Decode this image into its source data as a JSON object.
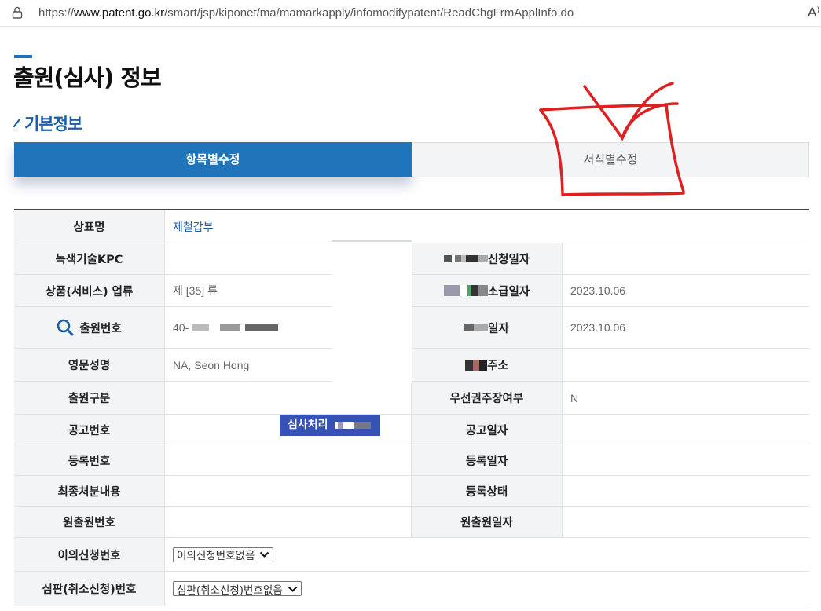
{
  "browser": {
    "url_prefix": "https://",
    "url_host": "www.patent.go.kr",
    "url_path": "/smart/jsp/kiponet/ma/mamarkapply/infomodifypatent/ReadChgFrmApplInfo.do",
    "reader_glyph": "A⁾"
  },
  "page": {
    "title": "출원(심사) 정보",
    "section_title": "기본정보"
  },
  "tabs": [
    {
      "label": "항목별수정",
      "active": true
    },
    {
      "label": "서식별수정",
      "active": false
    }
  ],
  "info": {
    "trademark_name_label": "상표명",
    "trademark_name_value": "제철갑부",
    "green_kpc_label": "녹색기술KPC",
    "request_date_label": "신청일자",
    "goods_class_label": "상품(서비스) 업류",
    "goods_class_value": "제 [35] 류",
    "retro_date_label": "소급일자",
    "retro_date_value": "2023.10.06",
    "app_number_label": "출원번호",
    "app_number_value": "40-",
    "exam_badge": "심사처리",
    "date_label": "일자",
    "date_value": "2023.10.06",
    "english_name_label": "영문성명",
    "english_name_value": "NA, Seon Hong",
    "address_label": "주소",
    "app_type_label": "출원구분",
    "priority_label": "우선권주장여부",
    "priority_value": "N",
    "pub_number_label": "공고번호",
    "pub_date_label": "공고일자",
    "reg_number_label": "등록번호",
    "reg_date_label": "등록일자",
    "final_disposition_label": "최종처분내용",
    "reg_status_label": "등록상태",
    "orig_app_number_label": "원출원번호",
    "orig_app_date_label": "원출원일자",
    "opposition_label": "이의신청번호",
    "opposition_select": "이의신청번호없음",
    "trial_label": "심판(취소신청)번호",
    "trial_select": "심판(취소신청)번호없음"
  },
  "colors": {
    "accent": "#1f74ba",
    "badge": "#3652b5",
    "scribble": "#e02020"
  }
}
